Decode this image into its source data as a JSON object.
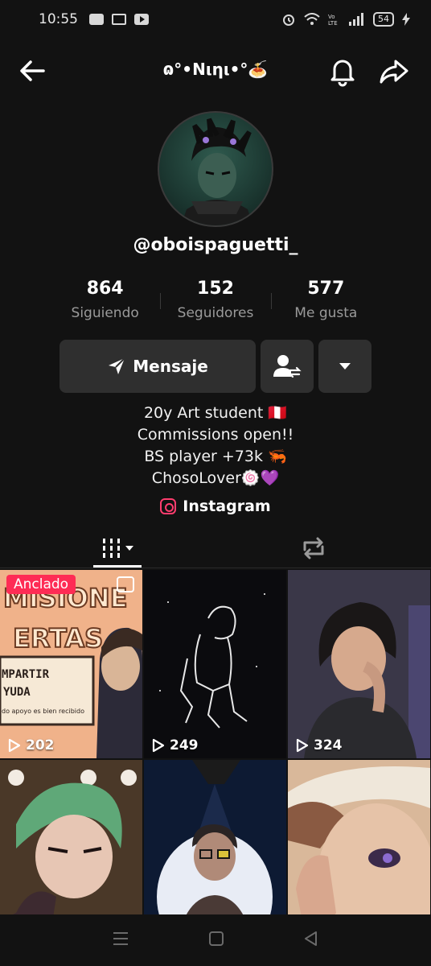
{
  "status_bar": {
    "time": "10:55",
    "battery": "54"
  },
  "header": {
    "title": "ɷ°•Νιηι•°🍝"
  },
  "profile": {
    "username": "@oboispaguetti_",
    "stats": [
      {
        "value": "864",
        "label": "Siguiendo"
      },
      {
        "value": "152",
        "label": "Seguidores"
      },
      {
        "value": "577",
        "label": "Me gusta"
      }
    ],
    "message_label": "Mensaje",
    "bio": [
      "20y Art student 🇵🇪",
      "Commissions open!!",
      "BS player +73k 🦐",
      "ChosoLover🍥💜"
    ],
    "link_label": "Instagram"
  },
  "grid": {
    "pinned_label": "Anclado",
    "tiles": [
      {
        "views": "202",
        "text_lines": [
          "MISIONE",
          "ERTAS",
          "MPARTIR",
          "YUDA",
          "do apoyo es bien recibido"
        ]
      },
      {
        "views": "249"
      },
      {
        "views": "324"
      },
      {
        "views": ""
      },
      {
        "views": ""
      },
      {
        "views": ""
      }
    ]
  },
  "icons": {
    "back": "arrow-left-icon",
    "bell": "bell-icon",
    "share": "share-icon",
    "message": "send-icon",
    "follow": "user-swap-icon",
    "more": "chevron-down-icon",
    "grid_tab": "grid-icon",
    "repost_tab": "repost-icon",
    "link": "instagram-icon"
  },
  "colors": {
    "background": "#121212",
    "button": "#2f2f2f",
    "accent_pin": "#fe2c55",
    "muted_text": "#9a9a9a"
  }
}
